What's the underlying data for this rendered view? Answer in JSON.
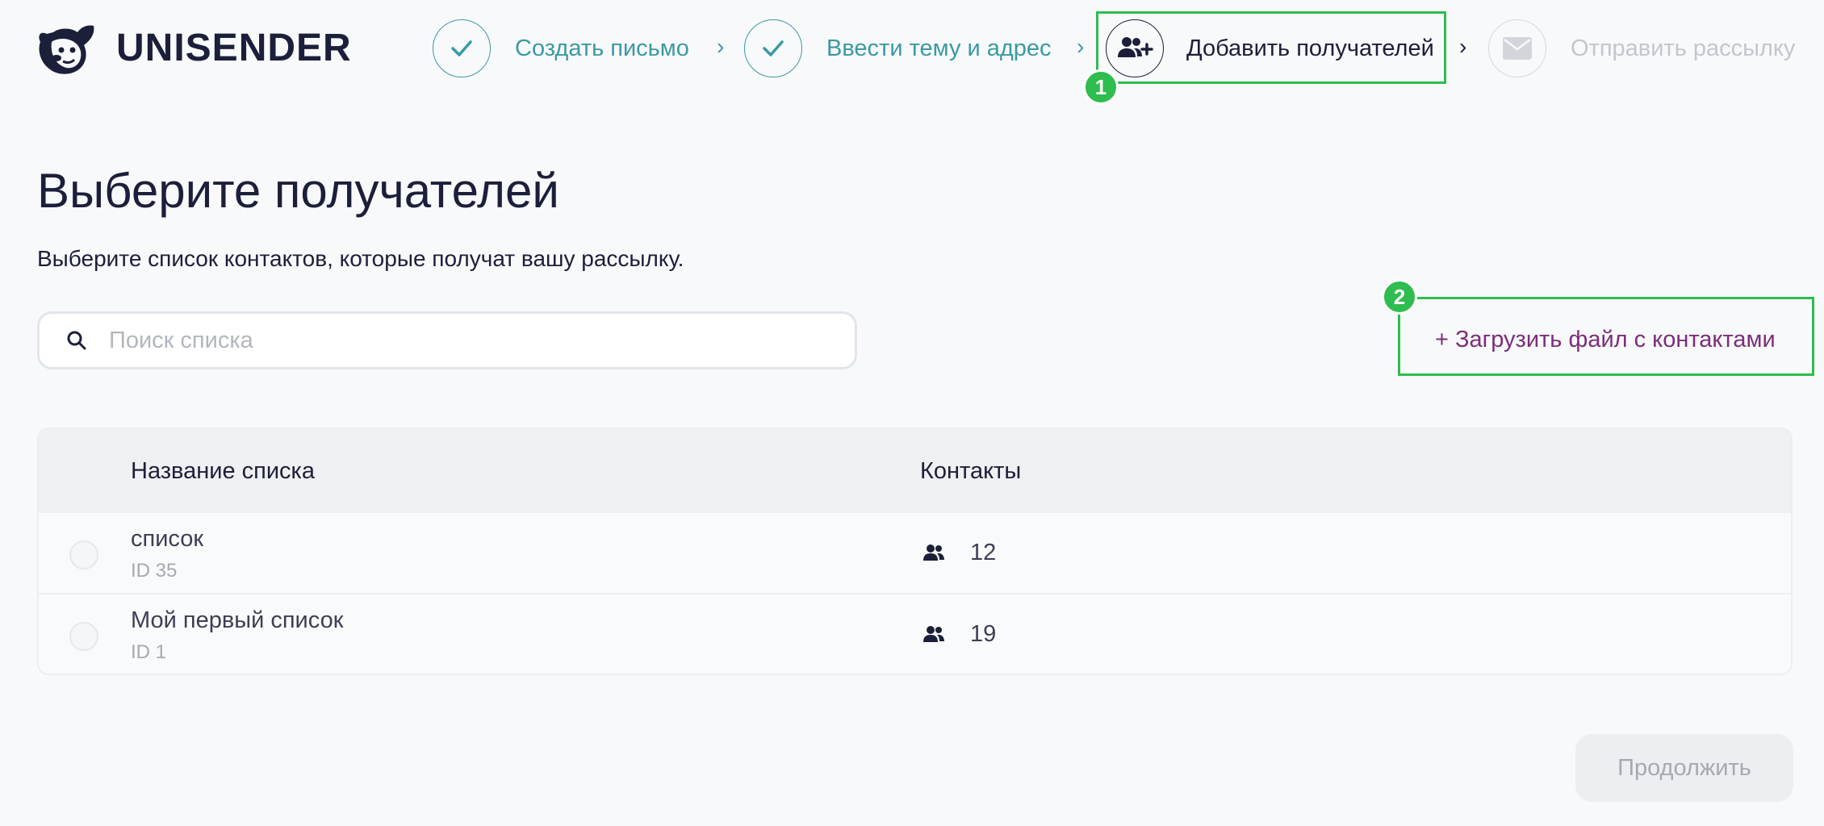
{
  "header": {
    "logo_text": "UNISENDER",
    "steps": [
      {
        "label": "Создать письмо",
        "state": "done",
        "icon": "check-icon"
      },
      {
        "label": "Ввести тему и адрес",
        "state": "done",
        "icon": "check-icon"
      },
      {
        "label": "Добавить получателей",
        "state": "active",
        "icon": "add-users-icon"
      },
      {
        "label": "Отправить рассылку",
        "state": "todo",
        "icon": "envelope-icon"
      }
    ]
  },
  "annotations": {
    "badge_1": "1",
    "badge_2": "2"
  },
  "main": {
    "title": "Выберите получателей",
    "subtitle": "Выберите список контактов, которые получат вашу рассылку.",
    "search_placeholder": "Поиск списка",
    "upload_link": "+ Загрузить файл с контактами",
    "table": {
      "columns": [
        "Название списка",
        "Контакты"
      ],
      "rows": [
        {
          "name": "список",
          "id": "ID 35",
          "contacts": "12"
        },
        {
          "name": "Мой первый список",
          "id": "ID 1",
          "contacts": "19"
        }
      ]
    },
    "continue_label": "Продолжить"
  },
  "colors": {
    "accent_done": "#3a9aa1",
    "text_dark": "#1c1f3a",
    "link_purple": "#7d2d7a",
    "highlight_green": "#2ebd4e"
  }
}
